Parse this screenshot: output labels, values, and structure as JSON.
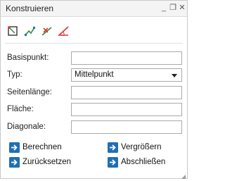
{
  "window": {
    "title": "Konstruieren",
    "controls": {
      "minimize": "_",
      "restore": "❐",
      "close": "✕"
    }
  },
  "toolbar": {
    "tools": [
      {
        "icon": "square-point-icon"
      },
      {
        "icon": "polyline-icon"
      },
      {
        "icon": "cross-line-icon"
      },
      {
        "icon": "angle-icon"
      }
    ]
  },
  "form": {
    "basispunkt_label": "Basispunkt:",
    "basispunkt_value": "",
    "typ_label": "Typ:",
    "typ_value": "Mittelpunkt",
    "seitenlaenge_label": "Seitenlänge:",
    "seitenlaenge_value": "",
    "flaeche_label": "Fläche:",
    "flaeche_value": "",
    "diagonale_label": "Diagonale:",
    "diagonale_value": ""
  },
  "actions": {
    "berechnen": "Berechnen",
    "vergroessern": "Vergrößern",
    "zuruecksetzen": "Zurücksetzen",
    "abschliessen": "Abschließen"
  },
  "colors": {
    "accent_blue": "#1f6fb5",
    "icon_red": "#d9342b",
    "icon_green": "#2a8c3a"
  }
}
